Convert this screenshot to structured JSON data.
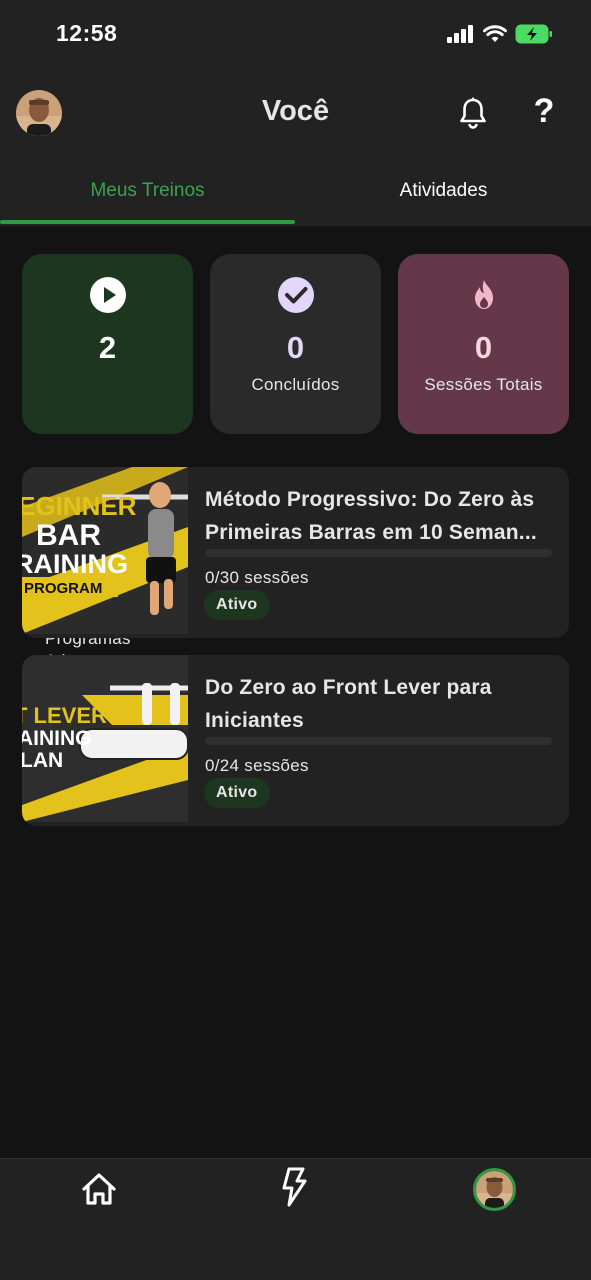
{
  "status_bar": {
    "time": "12:58"
  },
  "header": {
    "title": "Você",
    "help_glyph": "?",
    "icons": [
      "bell-icon",
      "help-icon"
    ]
  },
  "tabs": [
    {
      "label": "Meus Treinos",
      "active": true
    },
    {
      "label": "Atividades",
      "active": false
    }
  ],
  "stats": [
    {
      "icon": "play-icon",
      "value": "2",
      "label": "Programas Ativos",
      "color": "#1d3620"
    },
    {
      "icon": "check-icon",
      "value": "0",
      "label": "Concluídos",
      "color": "#2a2a2a"
    },
    {
      "icon": "flame-icon",
      "value": "0",
      "label": "Sessões Totais",
      "color": "#643849"
    }
  ],
  "programs": [
    {
      "title": "Método Progressivo: Do Zero às Primeiras Barras em 10 Seman...",
      "sessions": "0/30 sessões",
      "progress": 0,
      "status": "Ativo",
      "thumb_lines": [
        "EGINNER",
        "BAR",
        "RAINING",
        "PROGRAM"
      ]
    },
    {
      "title": "Do Zero ao Front Lever para Iniciantes",
      "sessions": "0/24 sessões",
      "progress": 0,
      "status": "Ativo",
      "thumb_lines": [
        "T LEVER",
        "AINING",
        "LAN"
      ]
    }
  ],
  "bottom_nav": {
    "items": [
      "home-icon",
      "bolt-icon",
      "profile-avatar"
    ]
  },
  "colors": {
    "accent": "#2f9a41",
    "background": "#131313",
    "surface": "#222222"
  }
}
